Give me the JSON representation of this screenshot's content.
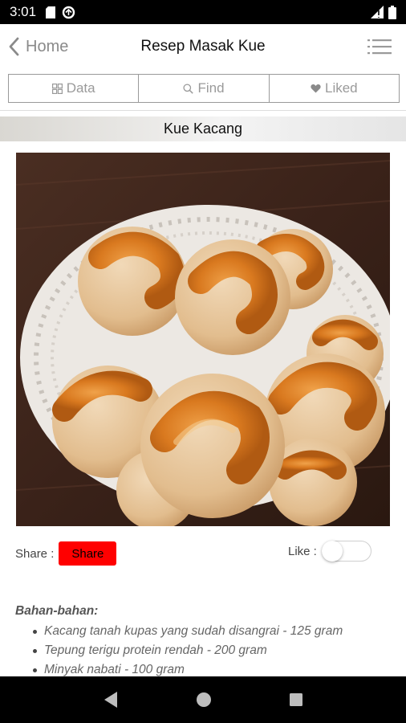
{
  "status_bar": {
    "time": "3:01"
  },
  "header": {
    "back_label": "Home",
    "title": "Resep Masak Kue"
  },
  "tabs": [
    {
      "label": "Data",
      "icon": "grid-icon"
    },
    {
      "label": "Find",
      "icon": "search-icon"
    },
    {
      "label": "Liked",
      "icon": "heart-icon"
    }
  ],
  "recipe": {
    "title": "Kue Kacang",
    "share_label": "Share :",
    "share_button": "Share",
    "like_label": "Like :",
    "like_enabled": false,
    "ingredients_heading": "Bahan-bahan:",
    "ingredients": [
      "Kacang tanah kupas yang sudah disangrai - 125 gram",
      "Tepung terigu protein rendah - 200 gram",
      "Minyak nabati - 100 gram"
    ]
  },
  "colors": {
    "share_button": "#ff0000",
    "status_bar": "#000000",
    "tab_border": "#9a9a9a"
  }
}
